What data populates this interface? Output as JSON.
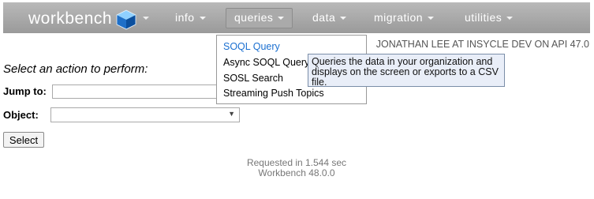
{
  "nav": {
    "logo_text": "workbench",
    "menus": [
      {
        "label": "info"
      },
      {
        "label": "queries"
      },
      {
        "label": "data"
      },
      {
        "label": "migration"
      },
      {
        "label": "utilities"
      }
    ]
  },
  "user_info": "JONATHAN LEE AT INSYCLE DEV ON API 47.0",
  "form": {
    "prompt": "Select an action to perform:",
    "jump_label": "Jump to:",
    "jump_value": "",
    "object_label": "Object:",
    "object_value": "",
    "select_button": "Select"
  },
  "queries_menu": {
    "items": [
      {
        "label": "SOQL Query",
        "highlighted": true
      },
      {
        "label": "Async SOQL Query",
        "highlighted": false
      },
      {
        "label": "SOSL Search",
        "highlighted": false
      },
      {
        "label": "Streaming Push Topics",
        "highlighted": false
      }
    ]
  },
  "tooltip": "Queries the data in your organization and displays on the screen or exports to a CSV file.",
  "footer": {
    "requested": "Requested in 1.544 sec",
    "version": "Workbench 48.0.0"
  },
  "colors": {
    "nav_bg": "#a8a8a8",
    "highlight_link": "#1a6fd0",
    "tooltip_bg": "#e9eef8"
  }
}
